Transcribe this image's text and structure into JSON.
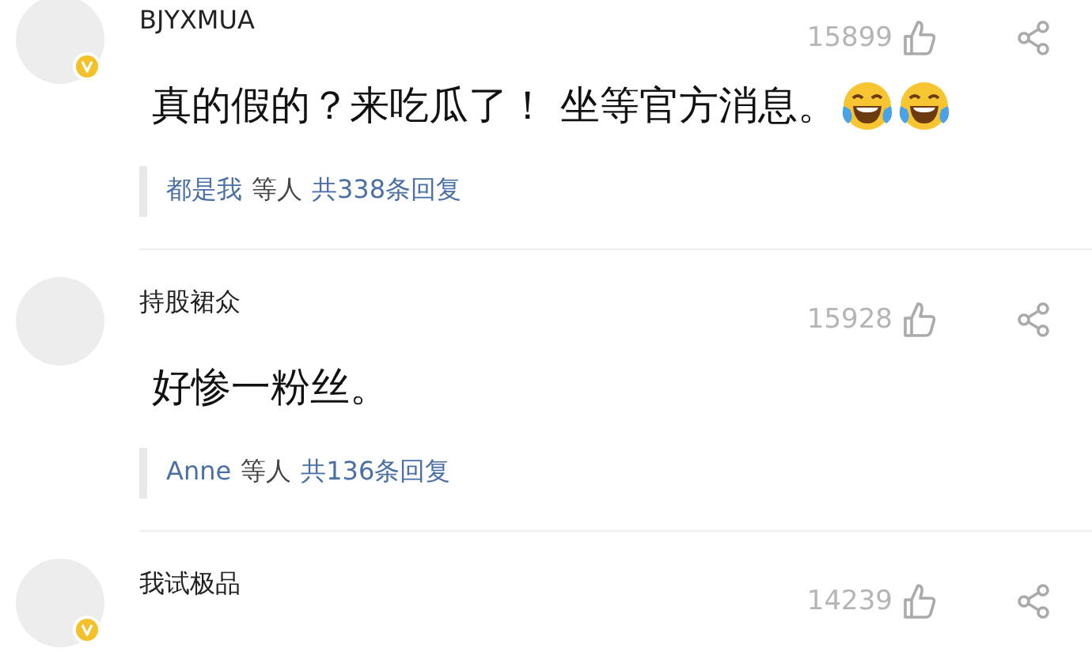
{
  "comments": [
    {
      "user": "BJYXMUA",
      "verified": true,
      "likes": "15899",
      "text": "真的假的？来吃瓜了！ 坐等官方消息。",
      "emojis": [
        {
          "kind": "laugh-cry"
        },
        {
          "kind": "laugh-cry"
        }
      ],
      "replies": {
        "users": "都是我",
        "etc": "等人",
        "total": "共338条回复"
      }
    },
    {
      "user": "持股裙众",
      "verified": false,
      "likes": "15928",
      "text": "好惨一粉丝。",
      "replies": {
        "users": "Anne",
        "etc": "等人",
        "total": "共136条回复"
      }
    },
    {
      "user": "我试极品",
      "verified": true,
      "likes": "14239"
    }
  ]
}
